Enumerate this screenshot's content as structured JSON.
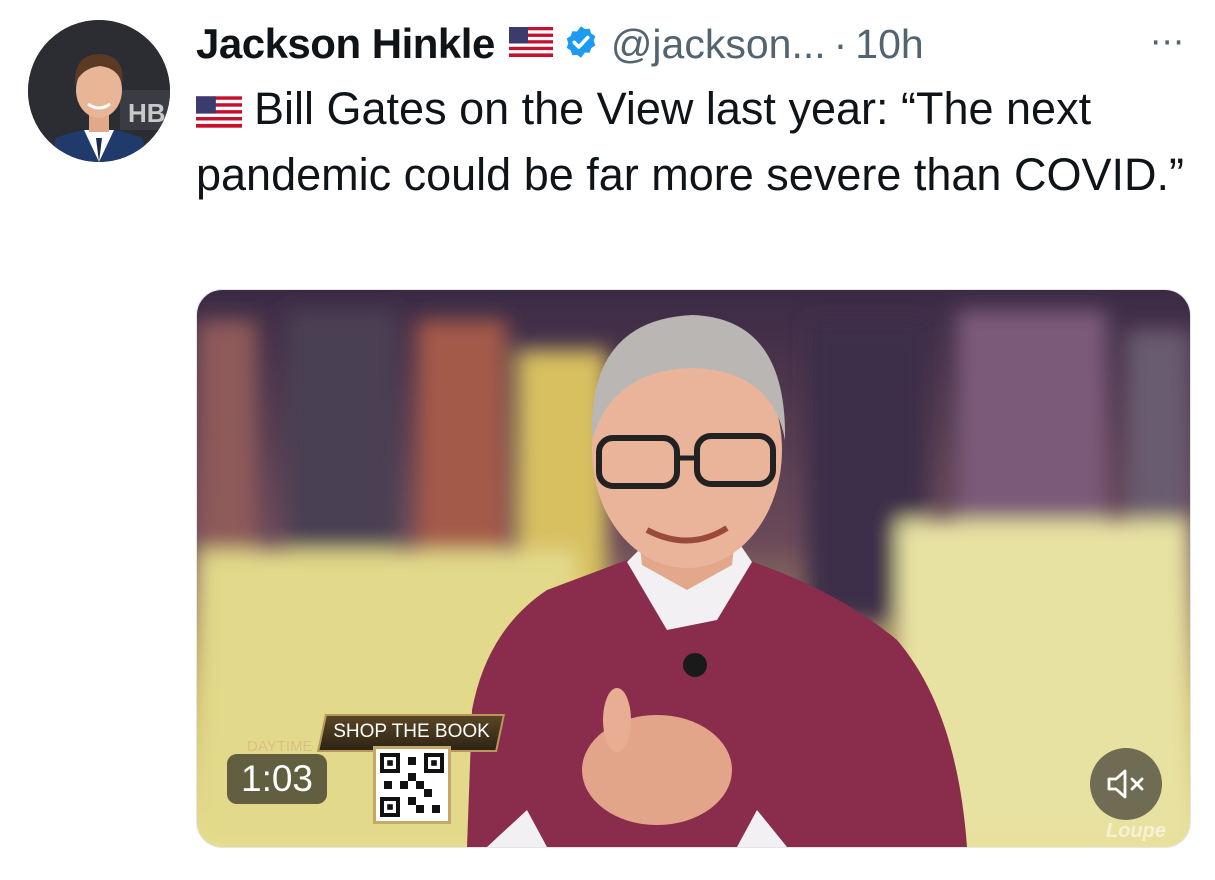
{
  "author": {
    "name": "Jackson Hinkle",
    "handle": "@jackson...",
    "separator": "·",
    "time": "10h",
    "avatar_icon": "profile-photo",
    "flag_icon": "us-flag-icon",
    "verified_icon": "verified-badge-icon",
    "verified_color": "#1d9bf0"
  },
  "more_icon": "⋯",
  "tweet": {
    "text": "Bill Gates on the View last year: “The next pandemic could be far more severe than COVID.”"
  },
  "media": {
    "duration": "1:03",
    "banner": "SHOP THE BOOK",
    "logo_text": "DAYTIME",
    "watermark": "Loupe",
    "mute_icon": "speaker-muted-icon"
  },
  "colors": {
    "text": "#0f1419",
    "secondary": "#536471",
    "sweater": "#8a2d4c",
    "banner_gold": "#b9975b"
  }
}
